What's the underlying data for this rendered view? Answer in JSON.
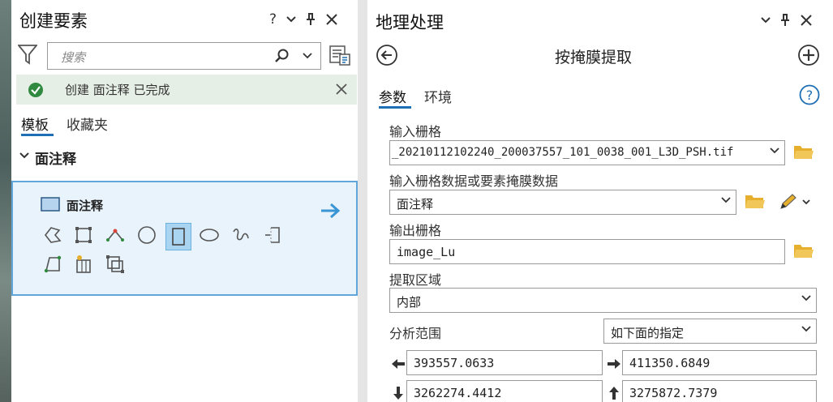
{
  "left_panel": {
    "title": "创建要素",
    "help": "?",
    "search": {
      "placeholder": "搜索"
    },
    "notice": {
      "text": "创建  面注释  已完成"
    },
    "tabs": [
      {
        "label": "模板",
        "active": true
      },
      {
        "label": "收藏夹",
        "active": false
      }
    ],
    "section": {
      "label": "面注释"
    },
    "template": {
      "name": "面注释",
      "tools": [
        "freehand-polygon-icon",
        "rectangle-box-icon",
        "polyline-vertex-icon",
        "circle-icon",
        "rectangle-icon",
        "ellipse-icon",
        "freehand-curve-icon",
        "trace-icon",
        "right-angle-polygon-icon",
        "auto-complete-icon",
        "split-box-icon"
      ],
      "selected_tool": "rectangle-icon"
    }
  },
  "right_panel": {
    "title": "地理处理",
    "tool_title": "按掩膜提取",
    "tabs": [
      {
        "label": "参数",
        "active": true
      },
      {
        "label": "环境",
        "active": false
      }
    ],
    "params": {
      "input_raster": {
        "label": "输入栅格",
        "value": "_20210112102240_200037557_101_0038_001_L3D_PSH.tif"
      },
      "mask": {
        "label": "输入栅格数据或要素掩膜数据",
        "value": "面注释"
      },
      "output_raster": {
        "label": "输出栅格",
        "value": "image_Lu"
      },
      "extraction_area": {
        "label": "提取区域",
        "value": "内部"
      },
      "analysis_extent": {
        "label": "分析范围",
        "option": "如下面的指定",
        "left": "393557.0633",
        "right": "411350.6849",
        "bottom": "3262274.4412",
        "top": "3275872.7379"
      }
    }
  },
  "colors": {
    "accent": "#1f6fb4",
    "folder": "#e6b02e",
    "success": "#2f8a3f",
    "selection": "#a9d4f2"
  }
}
